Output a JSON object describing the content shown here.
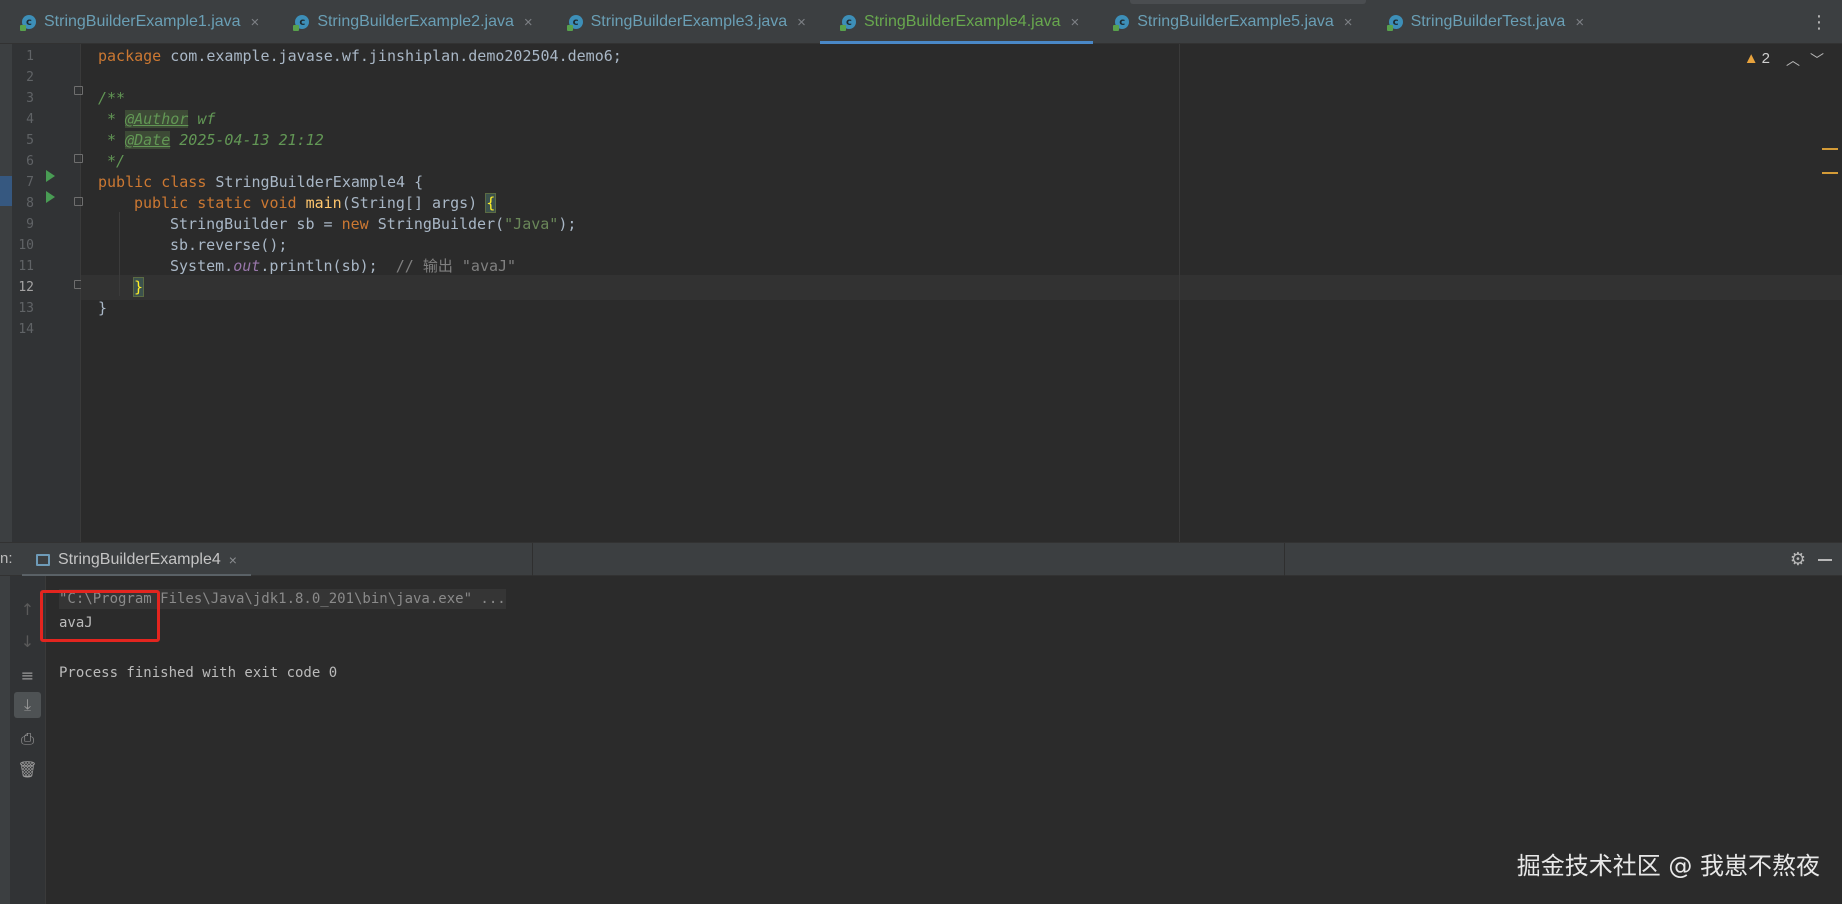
{
  "tabs": [
    {
      "label": "StringBuilderExample1.java",
      "active": false
    },
    {
      "label": "StringBuilderExample2.java",
      "active": false
    },
    {
      "label": "StringBuilderExample3.java",
      "active": false
    },
    {
      "label": "StringBuilderExample4.java",
      "active": true
    },
    {
      "label": "StringBuilderExample5.java",
      "active": false
    },
    {
      "label": "StringBuilderTest.java",
      "active": false
    }
  ],
  "editor": {
    "line_numbers": [
      "1",
      "2",
      "3",
      "4",
      "5",
      "6",
      "7",
      "8",
      "9",
      "10",
      "11",
      "12",
      "13",
      "14"
    ],
    "current_line": "12",
    "warning_count": "2",
    "code": {
      "l1_kw": "package",
      "l1_rest": " com.example.javase.wf.jinshiplan.demo202504.demo6;",
      "l3": "/**",
      "l4_star": " * ",
      "l4_tag": "@Author",
      "l4_val": " wf",
      "l5_star": " * ",
      "l5_tag": "@Date",
      "l5_val": " 2025-04-13 21:12",
      "l6": " */",
      "l7_kw": "public class",
      "l7_rest": " StringBuilderExample4 {",
      "l8_kw": "public static void",
      "l8_fn": "main",
      "l8_rest": "(String[] args) ",
      "l8_brace": "{",
      "l9_a": "StringBuilder sb = ",
      "l9_kw": "new",
      "l9_b": " StringBuilder(",
      "l9_str": "\"Java\"",
      "l9_c": ");",
      "l10": "sb.reverse();",
      "l11_a": "System.",
      "l11_static": "out",
      "l11_b": ".println(sb);",
      "l11_comment": "  // 输出 \"avaJ\"",
      "l12": "}",
      "l13": "}"
    }
  },
  "run_panel": {
    "label": "n:",
    "tab_label": "StringBuilderExample4",
    "console": {
      "command": "\"C:\\Program Files\\Java\\jdk1.8.0_201\\bin\\java.exe\" ...",
      "output": "avaJ",
      "exit": "Process finished with exit code 0"
    }
  },
  "watermark": "掘金技术社区 @ 我崽不熬夜",
  "colors": {
    "background": "#2b2b2b",
    "keyword": "#cc7832",
    "string": "#6a8759",
    "comment_doc": "#629755",
    "function": "#ffc66d",
    "highlight_box": "#e3251f",
    "active_tab_underline": "#4a88c7"
  }
}
